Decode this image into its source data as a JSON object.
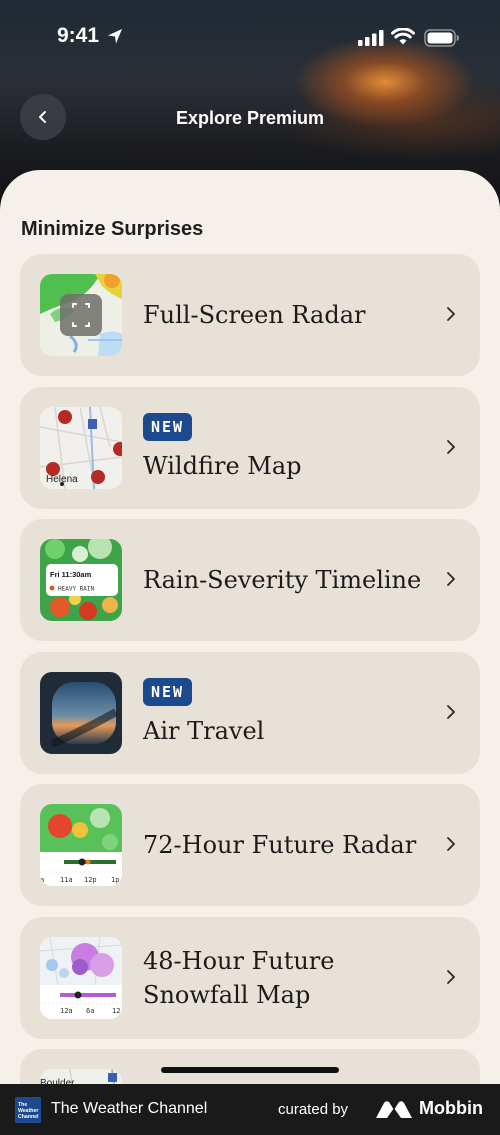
{
  "status_bar": {
    "time": "9:41"
  },
  "nav": {
    "title": "Explore Premium"
  },
  "section": {
    "title": "Minimize Surprises"
  },
  "items": [
    {
      "label": "Full-Screen Radar",
      "badge": ""
    },
    {
      "label": "Wildfire Map",
      "badge": "NEW",
      "thumb_text": "Helena"
    },
    {
      "label": "Rain-Severity Timeline",
      "badge": "",
      "thumb_time": "Fri 11:30am",
      "thumb_tag": "HEAVY RAIN"
    },
    {
      "label": "Air Travel",
      "badge": "NEW"
    },
    {
      "label": "72-Hour Future Radar",
      "badge": "",
      "thumb_ticks": [
        "a",
        "11a",
        "12p",
        "1p"
      ]
    },
    {
      "label": "48-Hour Future Snowfall Map",
      "badge": "",
      "thumb_ticks": [
        "12a",
        "6a",
        "12"
      ]
    },
    {
      "label": "",
      "badge": "",
      "thumb_text": "Boulder"
    }
  ],
  "footer": {
    "app_name": "The Weather Channel",
    "logo_text": "The Weather Channel",
    "curated_by": "curated by",
    "brand": "Mobbin"
  },
  "colors": {
    "badge": "#1d4a8f",
    "sheet": "#f6f0eb",
    "card": "#e7e1d8"
  }
}
